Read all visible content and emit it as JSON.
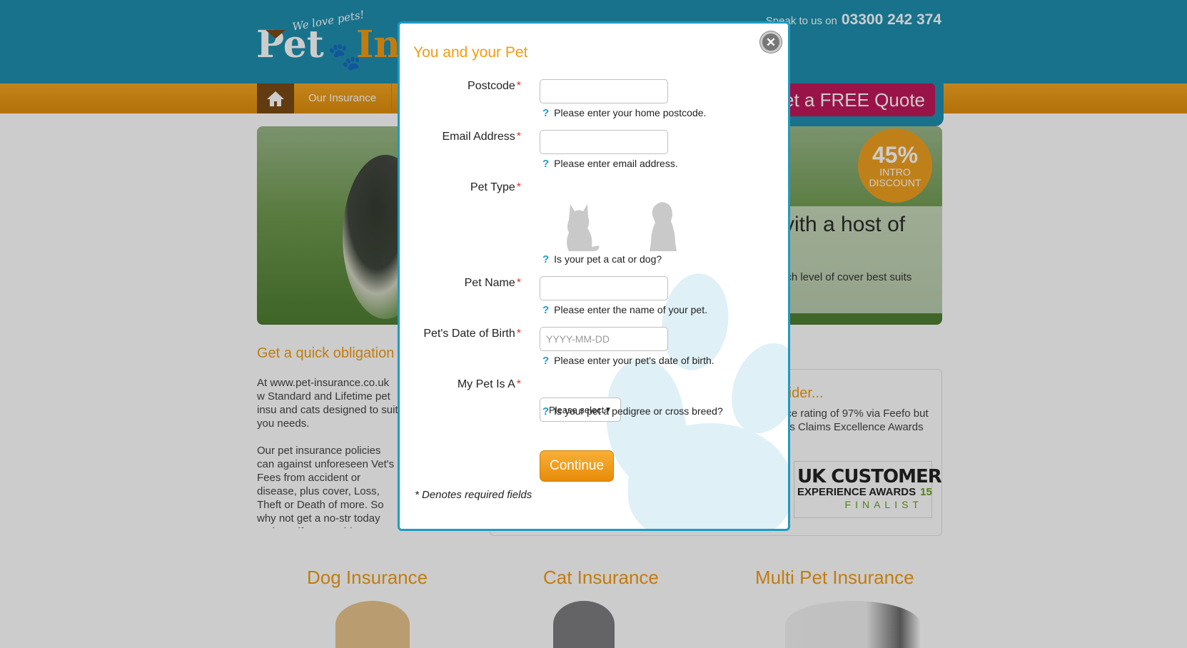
{
  "header": {
    "logo_tagline": "We love pets!",
    "logo_word1": "Pet",
    "logo_word2": "Ins",
    "phone_label": "Speak to us on",
    "phone_number": "03300 242 374"
  },
  "nav": {
    "home_icon": "home-icon",
    "link_our_insurance": "Our Insurance",
    "quote_button": "et a FREE Quote"
  },
  "hero": {
    "headline": "vith a host of",
    "subtext": "ich level of cover best suits",
    "badge_pct": "45%",
    "badge_line1": "INTRO",
    "badge_line2": "DISCOUNT"
  },
  "content": {
    "quick_title": "Get a quick obligation",
    "para1": "At www.pet-insurance.co.uk w Standard and Lifetime pet insu and cats designed to suit you needs.",
    "para2": "Our pet insurance policies can against unforeseen Vet's Fees from accident or disease, plus cover, Loss, Theft or Death of more. So why not get a no-str today and see if you could sa",
    "provider_title": "rider...",
    "provider_text": "ice rating of 97% via Feefo but es Claims Excellence Awards",
    "award_line1": "UK CUSTOMER",
    "award_line2": "EXPERIENCE AWARDS",
    "award_year": "15",
    "award_line3": "FINALIST"
  },
  "sections": {
    "dog": "Dog Insurance",
    "cat": "Cat Insurance",
    "multi": "Multi Pet Insurance"
  },
  "modal": {
    "title": "You and your Pet",
    "close_icon": "close-icon",
    "required_marker": "*",
    "fields": {
      "postcode": {
        "label": "Postcode",
        "value": "",
        "help": "Please enter your home postcode."
      },
      "email": {
        "label": "Email Address",
        "value": "",
        "help": "Please enter email address."
      },
      "pet_type": {
        "label": "Pet Type",
        "options": [
          "cat",
          "dog"
        ],
        "help": "Is your pet a cat or dog?"
      },
      "pet_name": {
        "label": "Pet Name",
        "value": "",
        "help": "Please enter the name of your pet."
      },
      "dob": {
        "label": "Pet's Date of Birth",
        "placeholder": "YYYY-MM-DD",
        "help": "Please enter your pet's date of birth."
      },
      "breed": {
        "label": "My Pet Is A",
        "selected": "Please select",
        "help": "Is your pet a pedigree or cross breed?"
      }
    },
    "help_icon": "?",
    "continue_label": "Continue",
    "required_note": "* Denotes required fields"
  },
  "colors": {
    "header_blue": "#1e8fb0",
    "accent_orange": "#f39c12",
    "quote_pink": "#c0185a",
    "modal_border": "#1e9cc2",
    "required_red": "#d9342b"
  }
}
